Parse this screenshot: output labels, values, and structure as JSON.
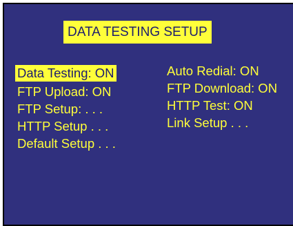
{
  "screen": {
    "title": "DATA TESTING SETUP",
    "left_column": [
      {
        "label": "Data Testing: ON",
        "selected": true
      },
      {
        "label": "FTP Upload: ON",
        "selected": false
      },
      {
        "label": "FTP Setup: . . .",
        "selected": false
      },
      {
        "label": "HTTP Setup . . .",
        "selected": false
      },
      {
        "label": "Default Setup . . .",
        "selected": false
      }
    ],
    "right_column": [
      {
        "label": "Auto Redial: ON",
        "selected": false
      },
      {
        "label": "FTP Download: ON",
        "selected": false
      },
      {
        "label": "HTTP Test: ON",
        "selected": false
      },
      {
        "label": "Link Setup . . .",
        "selected": false
      }
    ],
    "colors": {
      "background": "#30307e",
      "text": "#ffff3a",
      "highlight": "#ffff3a",
      "highlight_text": "#1c1c6e"
    }
  }
}
